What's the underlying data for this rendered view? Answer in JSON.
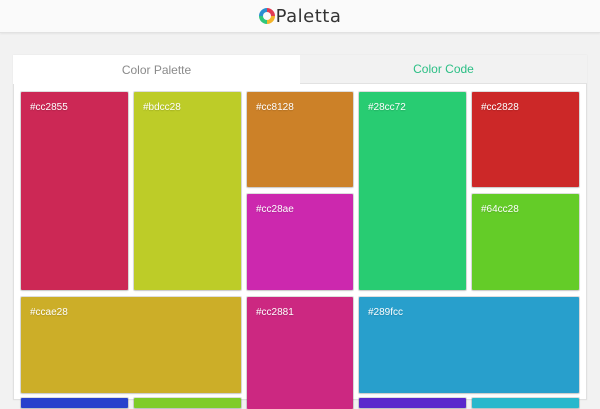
{
  "app": {
    "name": "Paletta"
  },
  "tabs": [
    {
      "label": "Color Palette",
      "active": true
    },
    {
      "label": "Color Code",
      "active": false
    }
  ],
  "colors": {
    "accent": "#2bbf85",
    "background": "#f2f2f2"
  },
  "swatches": [
    {
      "hex": "#cc2855"
    },
    {
      "hex": "#bdcc28"
    },
    {
      "hex": "#cc8128"
    },
    {
      "hex": "#28cc72"
    },
    {
      "hex": "#cc2828"
    },
    {
      "hex": "#cc28ae"
    },
    {
      "hex": "#64cc28"
    },
    {
      "hex": "#ccae28"
    },
    {
      "hex": "#cc2881"
    },
    {
      "hex": "#289fcc"
    }
  ]
}
